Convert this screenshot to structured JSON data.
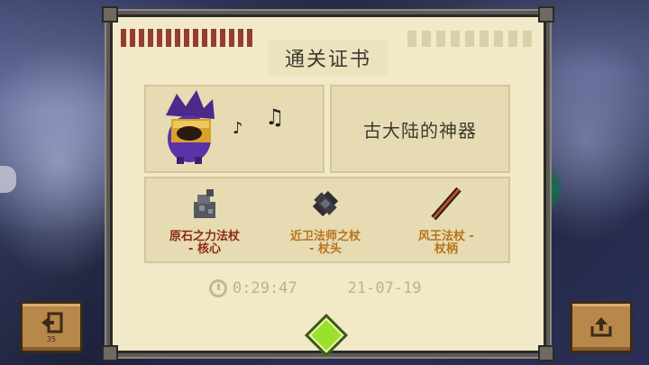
{
  "certificate": {
    "title": "通关证书",
    "level_name": "古大陆的神器",
    "weapons": [
      {
        "name": "原石之力法杖\n- 核心",
        "color": "#8c2a18"
      },
      {
        "name": "近卫法师之杖\n- 杖头",
        "color": "#b8741a"
      },
      {
        "name": "风王法杖 -\n杖柄",
        "color": "#b8741a"
      }
    ],
    "time": "0:29:47",
    "date": "21-07-19"
  },
  "buttons": {
    "exit_label": "35"
  },
  "icons": {
    "exit": "exit-door-icon",
    "share": "share-icon",
    "clock": "clock-icon",
    "gem": "gem-icon"
  }
}
